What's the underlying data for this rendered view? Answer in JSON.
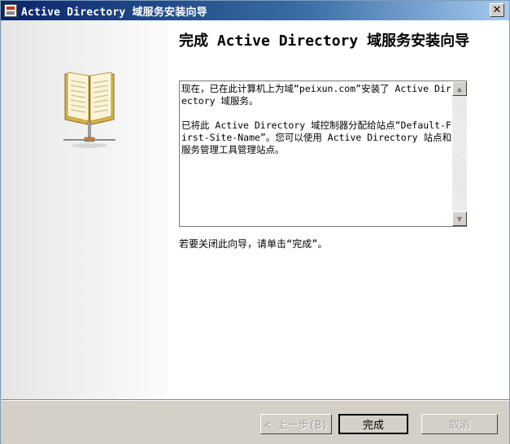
{
  "window": {
    "title": "Active Directory 域服务安装向导",
    "close_label": "✕"
  },
  "icons": {
    "title_icon": "wizard-app-icon",
    "side_icon": "open-book-network-icon"
  },
  "main": {
    "heading": "完成 Active Directory 域服务安装向导",
    "summary_paragraphs": [
      "现在，已在此计算机上为域“peixun.com”安装了 Active Directory 域服务。",
      "已将此 Active Directory 域控制器分配给站点“Default-First-Site-Name”。您可以使用 Active Directory 站点和服务管理工具管理站点。"
    ],
    "hint": "若要关闭此向导，请单击“完成”。"
  },
  "scrollbar": {
    "up_arrow": "▲",
    "down_arrow": "▼"
  },
  "buttons": {
    "back_label": "< 上一步(B)",
    "finish_label": "完成",
    "cancel_label": "取消"
  },
  "colors": {
    "titlebar_start": "#0a246a",
    "titlebar_end": "#a6caf0",
    "dialog_face": "#d4d0c8"
  }
}
